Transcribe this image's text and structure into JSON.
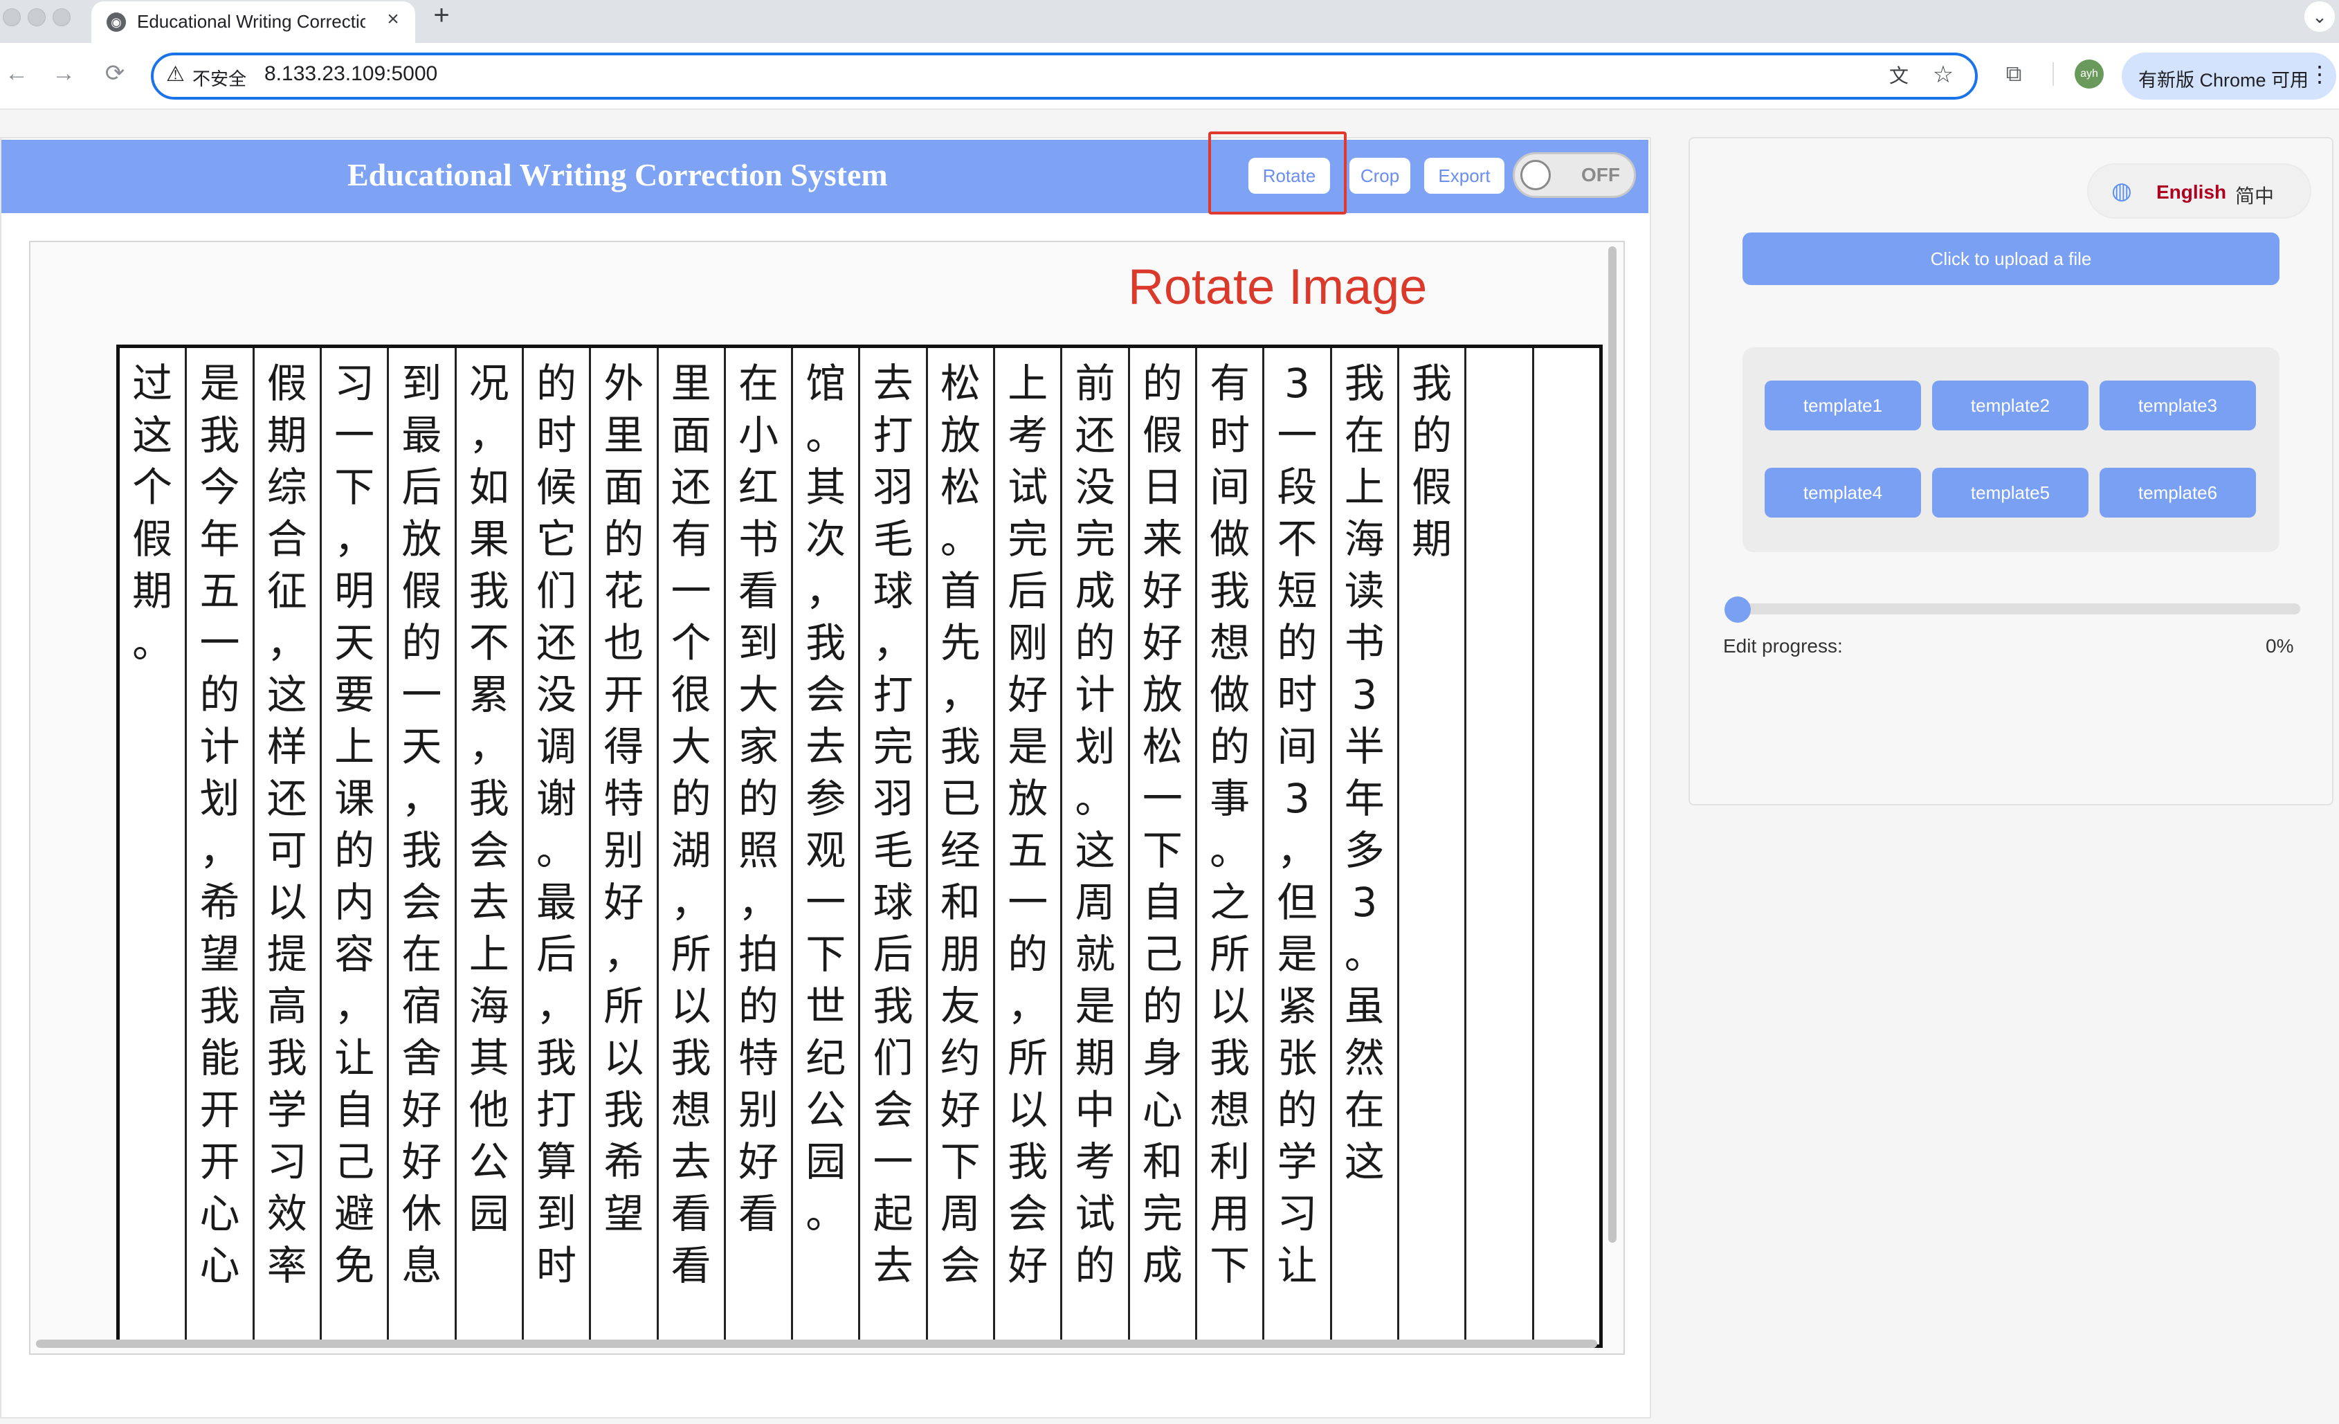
{
  "browser": {
    "tab_title": "Educational Writing Correctio",
    "tab_favicon": "globe-icon",
    "tab_close": "×",
    "new_tab": "+",
    "tab_menu": "⌄",
    "back": "←",
    "forward": "→",
    "reload": "⟳",
    "insecure_label": "不安全",
    "url": "8.133.23.109:5000",
    "update_label": "有新版 Chrome 可用",
    "update_menu": "⋮",
    "avatar_text": "ayh"
  },
  "app": {
    "title": "Educational Writing Correction System",
    "buttons": {
      "rotate": "Rotate",
      "crop": "Crop",
      "export": "Export"
    },
    "toggle": {
      "label": "OFF",
      "on": false
    },
    "annotation": "Rotate Image",
    "essay_columns": [
      "",
      "",
      "我的假期",
      "我在上海读书3半年多3。虽然在这",
      "3一段不短的时间3，但是紧张的学习让",
      "有时间做我想做的事。之所以我想利用下",
      "的假日来好好放松一下自己的身心和完成",
      "前还没完成的计划。这周就是期中考试的",
      "上考试完后刚好是放五一的，所以我会好",
      "松放松。首先，我已经和朋友约好下周会",
      "去打羽毛球，打完羽毛球后我们会一起去",
      "馆。其次，我会去参观一下世纪公园。",
      "在小红书看到大家的照，拍的特别好看",
      "里面还有一个很大的湖，所以我想去看看",
      "外里面的花也开得特别好，所以我希望",
      "的时候它们还没调谢。最后，我打算到时",
      "况，如果我不累，我会去上海其他公园",
      "到最后放假的一天，我会在宿舍好好休息",
      "习一下，明天要上课的内容，让自己避免",
      "假期综合征，这样还可以提高我学习效率",
      "是我今年五一的计划，希望我能开开心心",
      "过这个假期。"
    ]
  },
  "sidebar": {
    "lang_icon": "globe-icon",
    "lang_en": "English",
    "lang_zh": "简中",
    "upload_label": "Click to upload a file",
    "templates": [
      "template1",
      "template2",
      "template3",
      "template4",
      "template5",
      "template6"
    ],
    "progress_label": "Edit progress:",
    "progress_value": "0%",
    "progress_fraction": 0
  },
  "colors": {
    "accent": "#7ea3f5",
    "button": "#7aa0f4",
    "annotation": "#d93a2b",
    "language_active": "#b00020"
  }
}
